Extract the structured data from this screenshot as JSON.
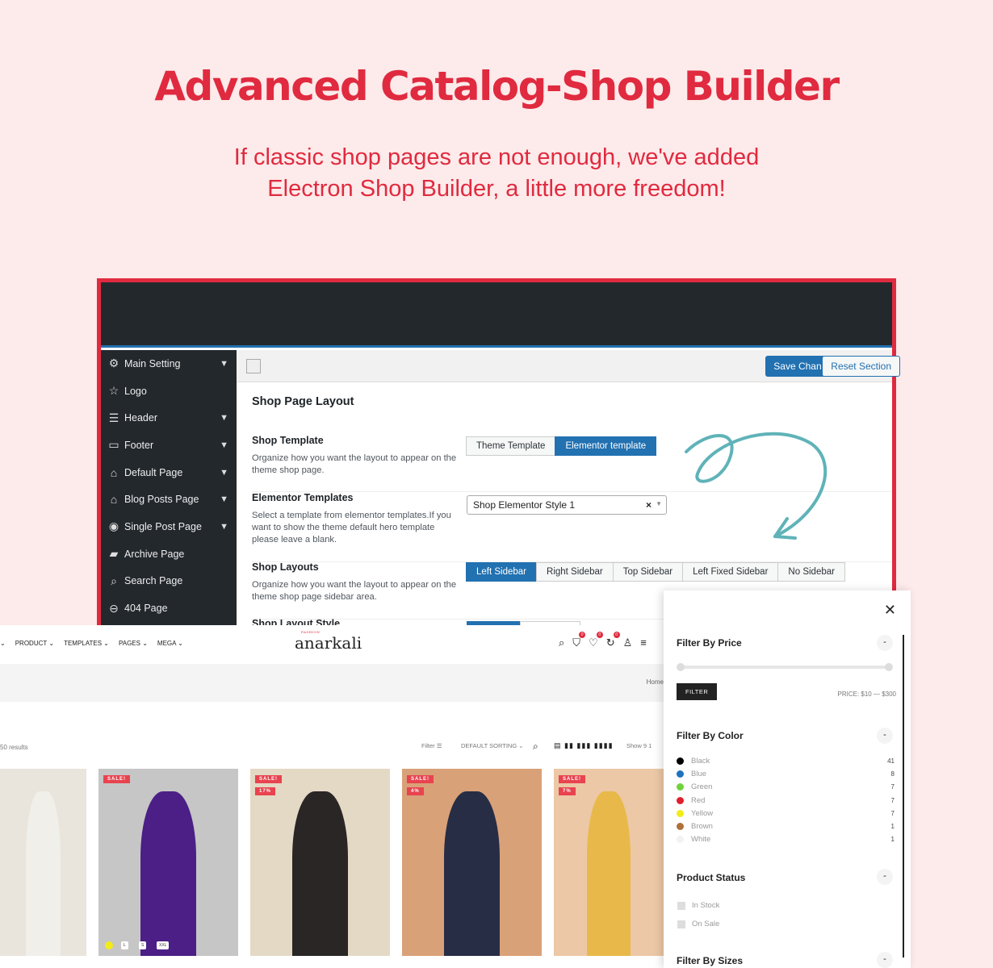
{
  "hero": {
    "title": "Advanced Catalog-Shop Builder",
    "subtitle": "If classic shop pages are not enough, we've added Electron Shop Builder, a little more freedom!"
  },
  "admin": {
    "sidebar": [
      {
        "label": "Main Setting",
        "icon": "gear-icon",
        "chevron": true
      },
      {
        "label": "Logo",
        "icon": "star-icon",
        "chevron": false
      },
      {
        "label": "Header",
        "icon": "menu-icon",
        "chevron": true
      },
      {
        "label": "Footer",
        "icon": "monitor-icon",
        "chevron": true
      },
      {
        "label": "Default Page",
        "icon": "home-icon",
        "chevron": true
      },
      {
        "label": "Blog Posts Page",
        "icon": "home-icon",
        "chevron": true
      },
      {
        "label": "Single Post Page",
        "icon": "circle-icon",
        "chevron": true
      },
      {
        "label": "Archive Page",
        "icon": "folder-icon",
        "chevron": false
      },
      {
        "label": "Search Page",
        "icon": "search-icon",
        "chevron": false
      },
      {
        "label": "404 Page",
        "icon": "minus-circle-icon",
        "chevron": false
      }
    ],
    "save": "Save Changes",
    "reset": "Reset Section",
    "section_title": "Shop Page Layout",
    "shop_template": {
      "title": "Shop Template",
      "desc": "Organize how you want the layout to appear on the theme shop page.",
      "options": [
        "Theme Template",
        "Elementor template"
      ],
      "selected": 1
    },
    "elementor_templates": {
      "title": "Elementor Templates",
      "desc": "Select a template from elementor templates.If you want to show the theme default hero template please leave a blank.",
      "value": "Shop Elementor Style 1"
    },
    "shop_layouts": {
      "title": "Shop Layouts",
      "desc": "Organize how you want the layout to appear on the theme shop page sidebar area.",
      "options": [
        "Left Sidebar",
        "Right Sidebar",
        "Top Sidebar",
        "Left Fixed Sidebar",
        "No Sidebar"
      ],
      "selected": 0
    },
    "shop_layout_style": {
      "title": "Shop Layout Style"
    }
  },
  "shop": {
    "nav": [
      "PRODUCT",
      "TEMPLATES",
      "PAGES",
      "MEGA"
    ],
    "logo": "anarkali",
    "logo_tag": "FASHION",
    "badges": [
      "0",
      "0",
      "0"
    ],
    "crumb": "Home",
    "results": "50 results",
    "filter": "Filter",
    "sorting": "DEFAULT SORTING",
    "show": "Show  9  1",
    "products": [
      {
        "badges": [],
        "color": "#e9e4dc",
        "fig": "#f1efe9"
      },
      {
        "badges": [
          "SALE!"
        ],
        "color": "#c6c6c6",
        "fig": "#4b1f86"
      },
      {
        "badges": [
          "SALE!",
          "17%"
        ],
        "color": "#e4d9c5",
        "fig": "#2a2626"
      },
      {
        "badges": [
          "SALE!",
          "4%"
        ],
        "color": "#d9a178",
        "fig": "#272d45"
      },
      {
        "badges": [
          "SALE!",
          "7%"
        ],
        "color": "#ecc8a6",
        "fig": "#e8b94a"
      }
    ],
    "sizes": [
      "L",
      "S",
      "XXL"
    ]
  },
  "filter_panel": {
    "price_title": "Filter By Price",
    "filter_btn": "FILTER",
    "price": "PRICE: $10 — $300",
    "color_title": "Filter By Color",
    "colors": [
      {
        "name": "Black",
        "count": "41",
        "hex": "#000000"
      },
      {
        "name": "Blue",
        "count": "8",
        "hex": "#1e73be"
      },
      {
        "name": "Green",
        "count": "7",
        "hex": "#6fd33c"
      },
      {
        "name": "Red",
        "count": "7",
        "hex": "#e0202f"
      },
      {
        "name": "Yellow",
        "count": "7",
        "hex": "#f3ec18"
      },
      {
        "name": "Brown",
        "count": "1",
        "hex": "#b0703a"
      },
      {
        "name": "White",
        "count": "1",
        "hex": "#f2f2f2"
      }
    ],
    "status_title": "Product Status",
    "status": [
      "In Stock",
      "On Sale"
    ],
    "sizes_title": "Filter By Sizes"
  },
  "colors": {
    "accent": "#e02a3f",
    "wp_blue": "#2271b1",
    "admin_dark": "#23282d",
    "arrow": "#5fb3b8"
  }
}
